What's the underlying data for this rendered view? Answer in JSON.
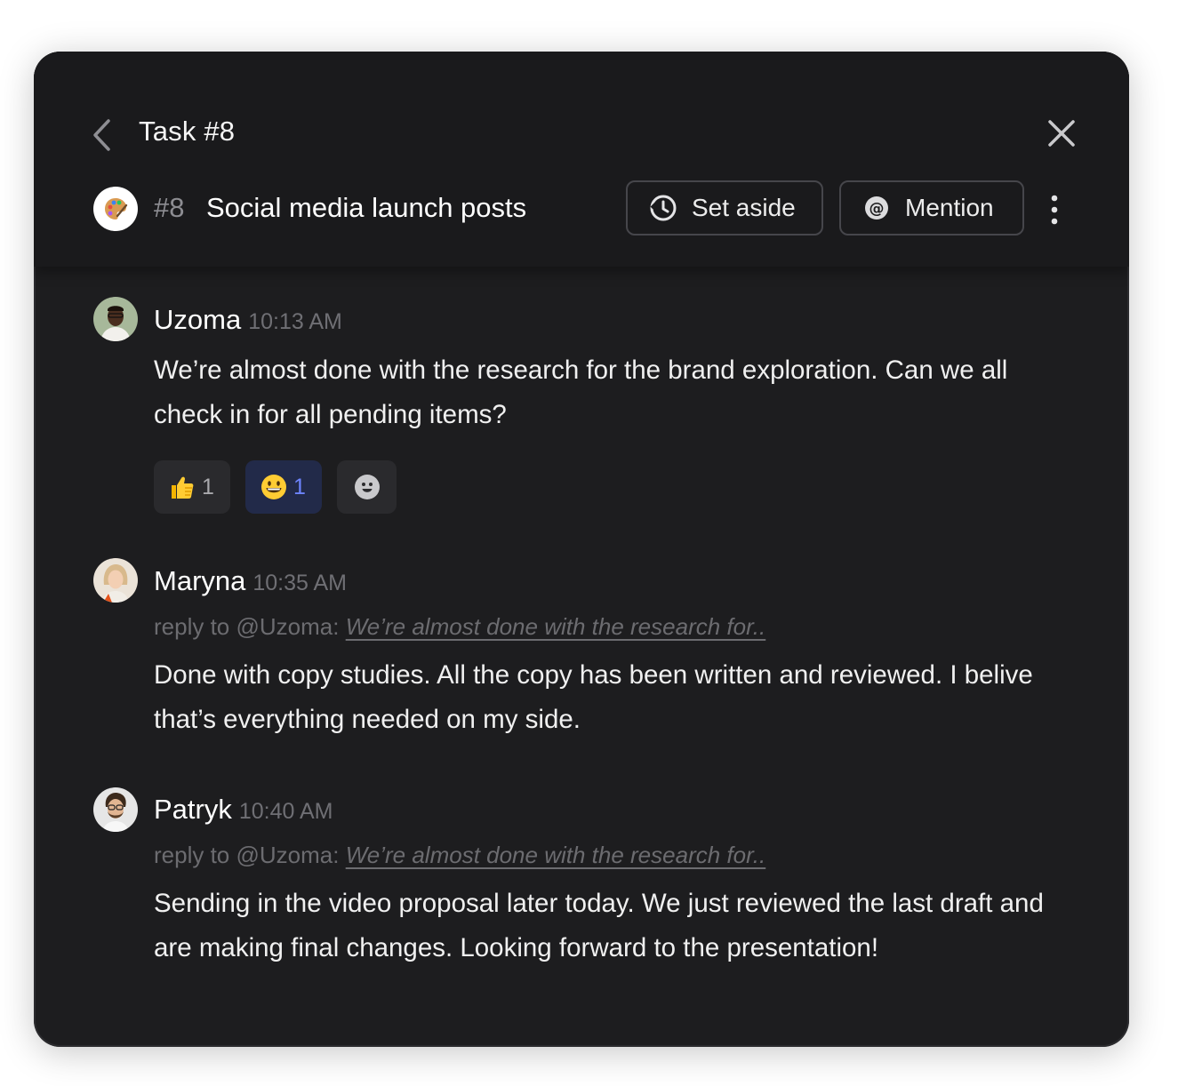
{
  "header": {
    "title": "Task #8",
    "task_number": "#8",
    "task_name": "Social media launch posts",
    "set_aside_label": "Set aside",
    "mention_label": "Mention"
  },
  "messages": [
    {
      "author": "Uzoma",
      "time": "10:13 AM",
      "text": "We’re almost done with the research for the brand exploration. Can we all check  in for all pending items?",
      "reactions": [
        {
          "emoji": "👍",
          "count": "1"
        },
        {
          "emoji": "😀",
          "count": "1"
        }
      ]
    },
    {
      "author": "Maryna",
      "time": "10:35 AM",
      "reply_prefix": "reply to @Uzoma: ",
      "reply_quote": "We’re almost done with the research for..",
      "text": "Done with copy studies. All the copy has been written and reviewed. I belive that’s everything needed on my side."
    },
    {
      "author": "Patryk",
      "time": "10:40 AM",
      "reply_prefix": "reply to @Uzoma: ",
      "reply_quote": "We’re almost done with the research for..",
      "text": "Sending in the video proposal later today. We just reviewed the last draft and are making final changes. Looking forward to the presentation!"
    }
  ],
  "colors": {
    "panel_bg": "#1d1d1f",
    "selected_reaction_bg": "#222a49",
    "selected_reaction_text": "#6d84ff"
  },
  "icons": [
    "chevron-left-icon",
    "close-icon",
    "palette-icon",
    "clock-icon",
    "at-icon",
    "more-vertical-icon",
    "add-reaction-icon"
  ]
}
